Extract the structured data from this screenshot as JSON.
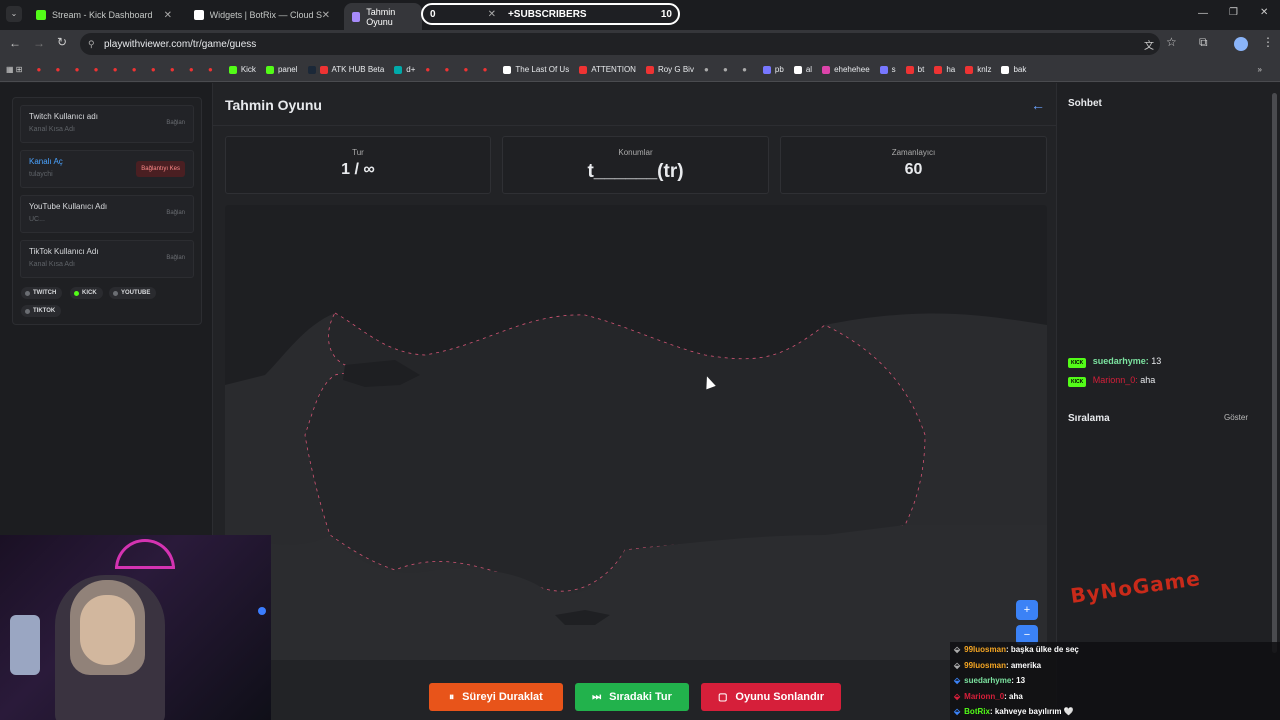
{
  "tabs": [
    {
      "label": "Stream - Kick Dashboard",
      "color": "#53fc18"
    },
    {
      "label": "Widgets | BotRix — Cloud Strea",
      "color": "#ffffff"
    },
    {
      "label": "Tahmin Oyunu",
      "color": "#a78bfa"
    }
  ],
  "subscribers": {
    "left": "0",
    "label": "SUBSCRIBERS",
    "right": "10"
  },
  "url": "playwithviewer.com/tr/game/guess",
  "bookmarks": [
    "Kick",
    "panel",
    "ATK HUB Beta",
    "d+",
    "The Last Of Us",
    "ATTENTION",
    "Roy G Biv",
    "pb",
    "al",
    "ehehehee",
    "s",
    "bt",
    "ha",
    "knlz",
    "bak"
  ],
  "left": {
    "fields": [
      {
        "label": "Twitch Kullanıcı adı",
        "placeholder": "Kanal Kısa Adı",
        "action": "Bağlan"
      },
      {
        "label": "Kanalı Aç",
        "placeholder": "tulaychi",
        "action": "Bağlantıyı Kes"
      },
      {
        "label": "YouTube Kullanıcı Adı",
        "placeholder": "UC...",
        "action": "Bağlan"
      },
      {
        "label": "TikTok Kullanıcı Adı",
        "placeholder": "Kanal Kısa Adı",
        "action": "Bağlan"
      }
    ],
    "chips": [
      "TWITCH",
      "KICK",
      "YOUTUBE",
      "TIKTOK"
    ]
  },
  "game": {
    "title": "Tahmin Oyunu",
    "round_label": "Tur",
    "round_value": "1 / ∞",
    "location_label": "Konumlar",
    "location_value": "t______(tr)",
    "timer_label": "Zamanlayıcı",
    "timer_value": "60",
    "zoom_in": "+",
    "zoom_out": "−"
  },
  "buttons": {
    "pause": "Süreyi Duraklat",
    "next": "Sıradaki Tur",
    "end": "Oyunu Sonlandır"
  },
  "right": {
    "chat_title": "Sohbet",
    "messages": [
      {
        "platform": "KICK",
        "user": "suedarhyme:",
        "text": "13"
      },
      {
        "platform": "KICK",
        "user": "Marionn_0:",
        "text": "aha"
      }
    ],
    "ranking_title": "Sıralama",
    "ranking_action": "Göster"
  },
  "overlay_chat": [
    {
      "user": "99luosman",
      "text": ": başka ülke de seç"
    },
    {
      "user": "99luosman",
      "text": ": amerika"
    },
    {
      "user": "suedarhyme",
      "text": ": 13"
    },
    {
      "user": "Marionn_0",
      "text": ": aha"
    },
    {
      "user": "BotRix",
      "text": ": kahveye bayılırım 🤍"
    }
  ],
  "logo_text": "ByNoGame",
  "colors": {
    "kick": "#53fc18",
    "orange": "#e8541a",
    "green": "#22b24c",
    "red": "#d61f3a",
    "accent": "#3b82f6"
  }
}
